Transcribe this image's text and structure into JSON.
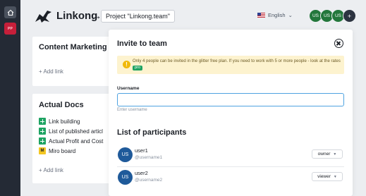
{
  "rail": {
    "home_icon": "home-icon",
    "project_badge": "PP"
  },
  "header": {
    "brand": "Linkong",
    "arrow": "→",
    "project": "Project \"Linkong.team\"",
    "language": "English",
    "language_chevron": "⌄",
    "avatars": [
      "US",
      "US",
      "US"
    ],
    "more_avatars": "+"
  },
  "cards": [
    {
      "title": "Content Marketing",
      "add_link": "+ Add link"
    },
    {
      "title": "Actual Docs",
      "docs": [
        {
          "label": "Link building",
          "icon": "google-sheets-icon"
        },
        {
          "label": "List of published articl",
          "icon": "google-sheets-icon"
        },
        {
          "label": "Actual Profit and Cost",
          "icon": "google-sheets-icon"
        },
        {
          "label": "Miro board",
          "icon": "miro-icon"
        }
      ],
      "add_link": "+ Add link"
    }
  ],
  "modal": {
    "title": "Invite to team",
    "notice": "Only 4 people can be invited in the glitter free plan. If you need to work with 5 or more people - look at the rates",
    "pro_badge": "pro",
    "username_label": "Username",
    "username_value": "",
    "username_hint": "Enter username",
    "participants_title": "List of participants",
    "participants": [
      {
        "initials": "US",
        "name": "user1",
        "handle": "@username1",
        "role": "owner"
      },
      {
        "initials": "US",
        "name": "user2",
        "handle": "@username2",
        "role": "viewer"
      }
    ]
  },
  "colors": {
    "rail": "#242a35",
    "accent_red": "#c61f3a",
    "avatar_green": "#23773b",
    "participant_avatar": "#1f5a9a",
    "input_focus": "#4ea3e0",
    "notice_bg": "#fdf3cf",
    "pro_green": "#1ea362"
  }
}
